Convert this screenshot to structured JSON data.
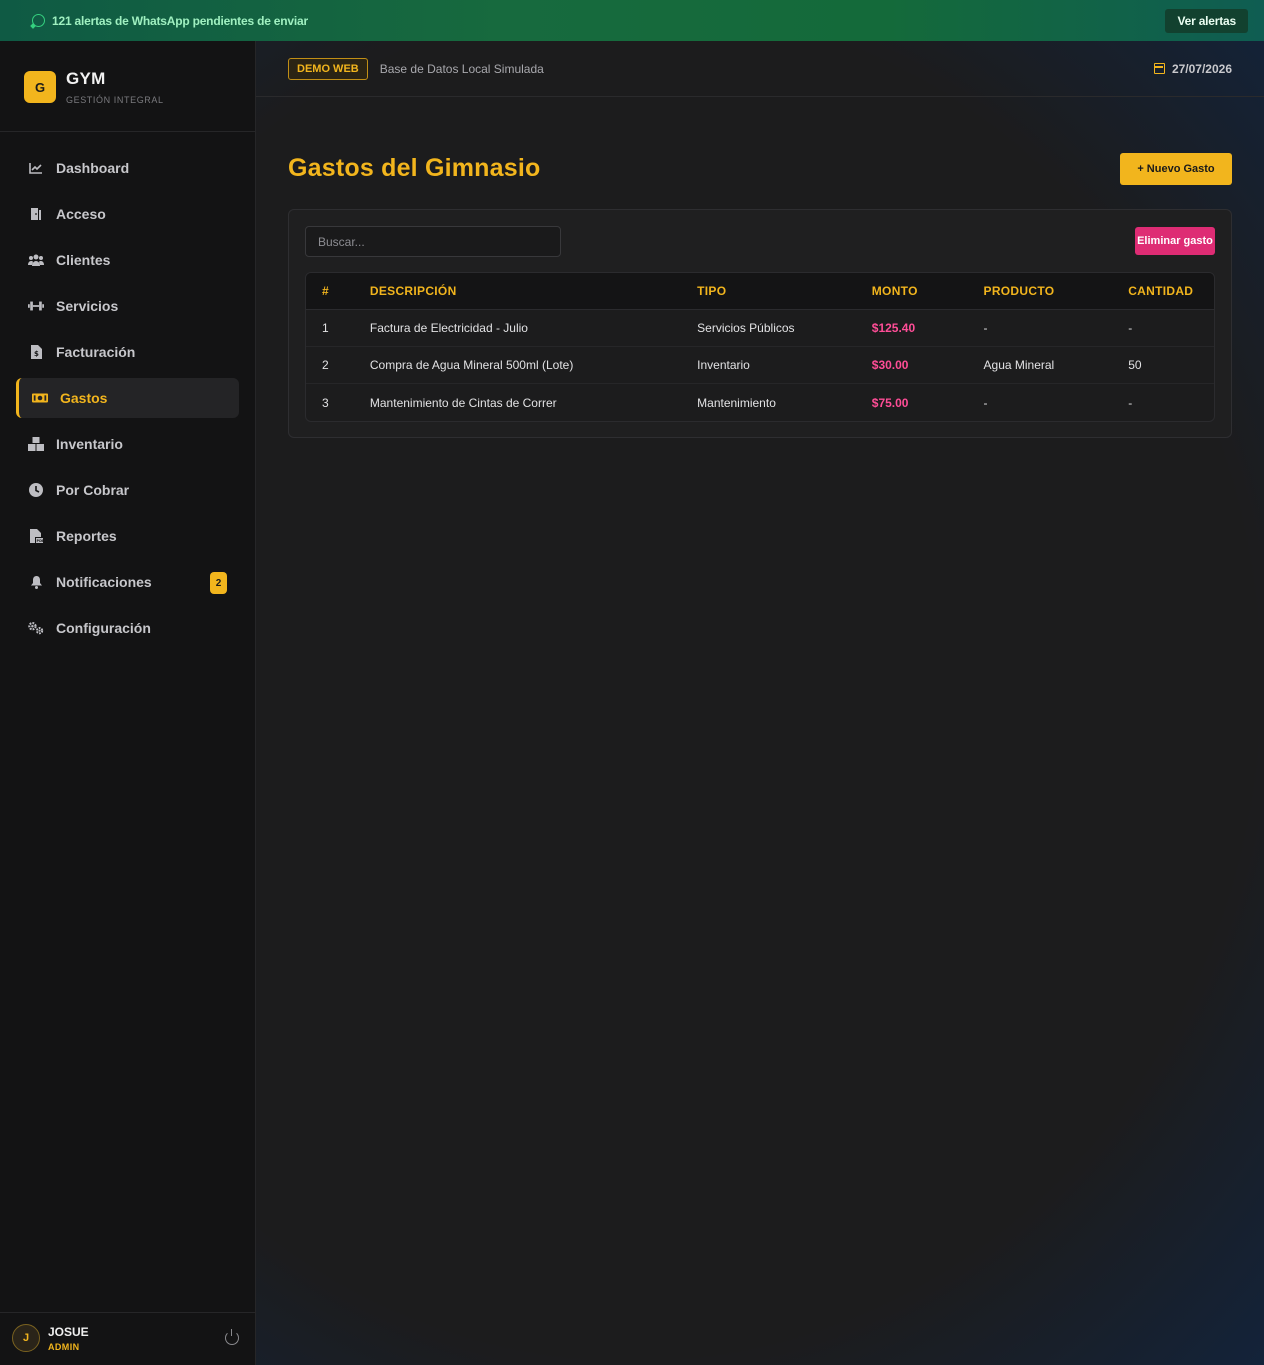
{
  "alert": {
    "text": "121 alertas de WhatsApp pendientes de enviar",
    "button": "Ver alertas"
  },
  "brand": {
    "logo": "G",
    "name": "GYM",
    "subtitle": "GESTIÓN INTEGRAL"
  },
  "nav": [
    {
      "label": "Dashboard",
      "icon": "chart-line-icon"
    },
    {
      "label": "Acceso",
      "icon": "door-icon"
    },
    {
      "label": "Clientes",
      "icon": "users-icon"
    },
    {
      "label": "Servicios",
      "icon": "dumbbell-icon"
    },
    {
      "label": "Facturación",
      "icon": "invoice-icon"
    },
    {
      "label": "Gastos",
      "icon": "money-icon",
      "active": true
    },
    {
      "label": "Inventario",
      "icon": "boxes-icon"
    },
    {
      "label": "Por Cobrar",
      "icon": "clock-icon"
    },
    {
      "label": "Reportes",
      "icon": "file-pdf-icon"
    },
    {
      "label": "Notificaciones",
      "icon": "bell-icon",
      "badge": "2"
    },
    {
      "label": "Configuración",
      "icon": "gears-icon"
    }
  ],
  "user": {
    "initial": "J",
    "name": "JOSUE",
    "role": "ADMIN"
  },
  "header": {
    "badge": "DEMO WEB",
    "db_text": "Base de Datos Local Simulada",
    "date": "27/07/2026"
  },
  "page": {
    "title": "Gastos del Gimnasio",
    "new_button": "+ Nuevo Gasto",
    "search_placeholder": "Buscar...",
    "delete_button": "Eliminar gasto"
  },
  "table": {
    "headers": [
      "#",
      "DESCRIPCIÓN",
      "TIPO",
      "MONTO",
      "PRODUCTO",
      "CANTIDAD"
    ],
    "rows": [
      [
        "1",
        "Factura de Electricidad - Julio",
        "Servicios Públicos",
        "$125.40",
        "-",
        "-"
      ],
      [
        "2",
        "Compra de Agua Mineral 500ml (Lote)",
        "Inventario",
        "$30.00",
        "Agua Mineral",
        "50"
      ],
      [
        "3",
        "Mantenimiento de Cintas de Correr",
        "Mantenimiento",
        "$75.00",
        "-",
        "-"
      ]
    ]
  },
  "colors": {
    "accent": "#f2b51d",
    "danger": "#de2c74",
    "amount": "#ff4d97",
    "alert_bg": "#176a3e"
  }
}
